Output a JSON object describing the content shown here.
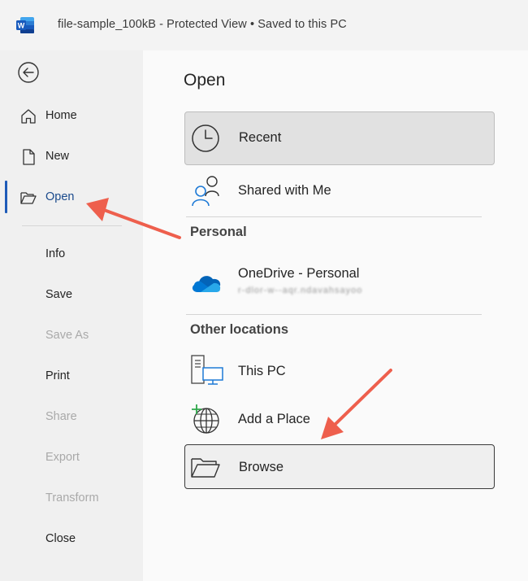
{
  "titlebar": {
    "title": "file-sample_100kB  -  Protected View • Saved to this PC"
  },
  "sidebar": {
    "items": [
      {
        "label": "Home"
      },
      {
        "label": "New"
      },
      {
        "label": "Open"
      },
      {
        "label": "Info"
      },
      {
        "label": "Save"
      },
      {
        "label": "Save As"
      },
      {
        "label": "Print"
      },
      {
        "label": "Share"
      },
      {
        "label": "Export"
      },
      {
        "label": "Transform"
      },
      {
        "label": "Close"
      }
    ],
    "active": "Open"
  },
  "main": {
    "title": "Open",
    "recent_label": "Recent",
    "shared_label": "Shared with Me",
    "personal_header": "Personal",
    "onedrive_label": "OneDrive - Personal",
    "onedrive_sub": "r-dlor-w--aqr.ndavahsayoo",
    "other_header": "Other locations",
    "thispc_label": "This PC",
    "addplace_label": "Add a Place",
    "browse_label": "Browse"
  },
  "colors": {
    "active_accent": "#1e5bb8",
    "annotation_arrow": "#ee5f4d",
    "word_blue": "#185abd"
  },
  "icons": [
    "word-app-icon",
    "back-arrow-icon",
    "home-icon",
    "new-document-icon",
    "folder-open-icon",
    "clock-icon",
    "people-icon",
    "onedrive-cloud-icon",
    "computer-icon",
    "globe-add-icon",
    "folder-icon"
  ]
}
